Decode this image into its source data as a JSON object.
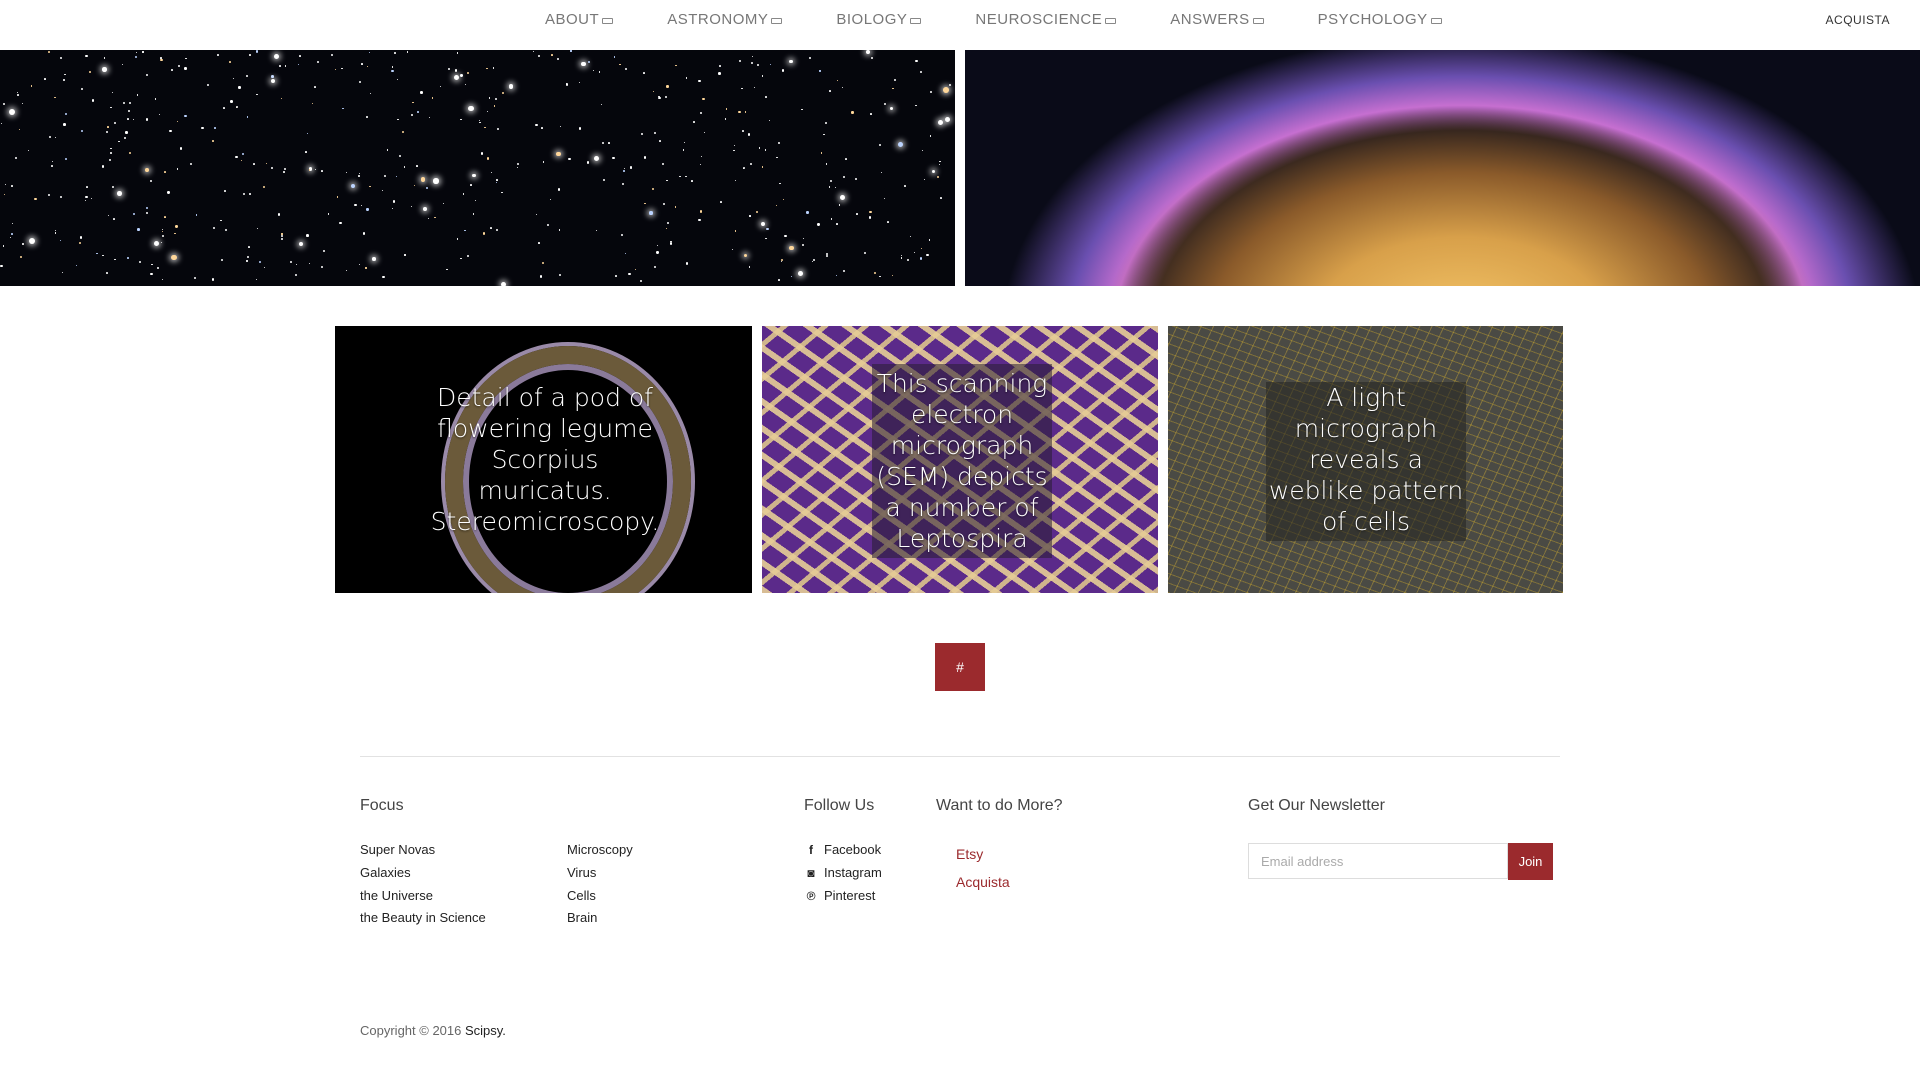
{
  "nav": {
    "items": [
      {
        "label": "ABOUT"
      },
      {
        "label": "ASTRONOMY"
      },
      {
        "label": "BIOLOGY"
      },
      {
        "label": "NEUROSCIENCE"
      },
      {
        "label": "ANSWERS"
      },
      {
        "label": "PSYCHOLOGY"
      }
    ],
    "right_link": "ACQUISTA"
  },
  "tiles": [
    {
      "caption": "Detail of a pod of flowering legume Scorpius muricatus. Stereomicroscopy."
    },
    {
      "caption": "This scanning electron micrograph (SEM) depicts a number of Leptospira"
    },
    {
      "caption": "A light micrograph reveals a weblike pattern of cells"
    }
  ],
  "pagination": {
    "label": "#"
  },
  "footer": {
    "focus": {
      "title": "Focus",
      "col1": [
        "Super Novas",
        "Galaxies",
        "the Universe",
        "the Beauty in Science"
      ],
      "col2": [
        "Microscopy",
        "Virus",
        "Cells",
        "Brain"
      ]
    },
    "follow": {
      "title": "Follow Us",
      "items": [
        {
          "label": "Facebook",
          "icon": "f"
        },
        {
          "label": "Instagram",
          "icon": "◙"
        },
        {
          "label": "Pinterest",
          "icon": "℗"
        }
      ]
    },
    "more": {
      "title": "Want to do More?",
      "links": [
        "Etsy",
        "Acquista"
      ]
    },
    "newsletter": {
      "title": "Get Our Newsletter",
      "placeholder": "Email address",
      "button": "Join"
    },
    "copyright": {
      "text": "Copyright © 2016 ",
      "brand": "Scipsy."
    }
  },
  "colors": {
    "accent": "#9b2a2d"
  }
}
